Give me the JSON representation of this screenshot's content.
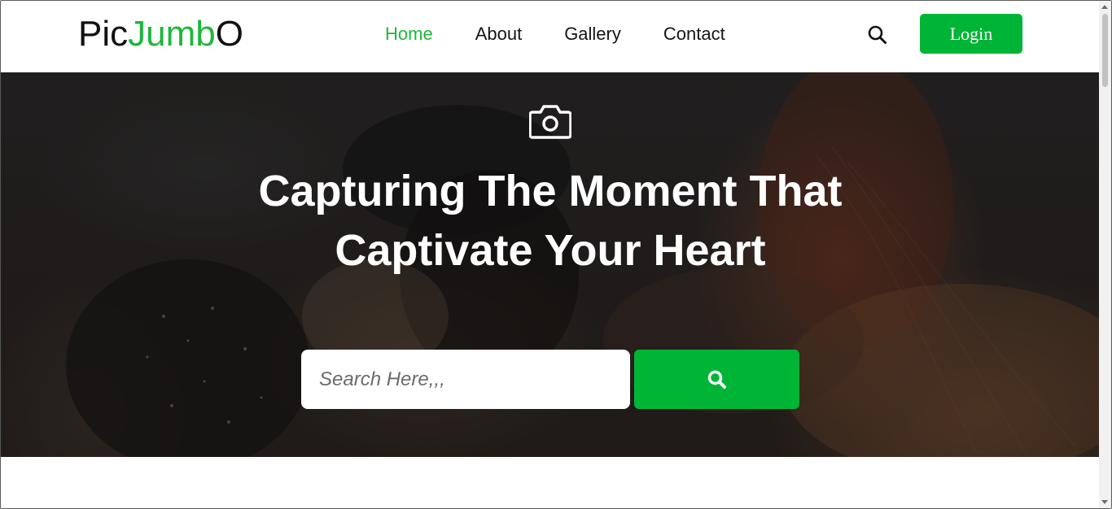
{
  "brand": {
    "part1": "Pic",
    "part2": "Jumb",
    "part3": "O"
  },
  "nav": {
    "items": [
      {
        "label": "Home",
        "active": true
      },
      {
        "label": "About",
        "active": false
      },
      {
        "label": "Gallery",
        "active": false
      },
      {
        "label": "Contact",
        "active": false
      }
    ]
  },
  "header": {
    "search_icon": "search-icon",
    "login_label": "Login"
  },
  "hero": {
    "icon": "camera-icon",
    "headline": "Capturing The Moment That Captivate Your Heart",
    "search": {
      "placeholder": "Search Here,,,",
      "value": "",
      "button_icon": "search-icon"
    }
  },
  "colors": {
    "accent": "#00b536",
    "brand_green": "#1fb73a",
    "text": "#151515"
  }
}
